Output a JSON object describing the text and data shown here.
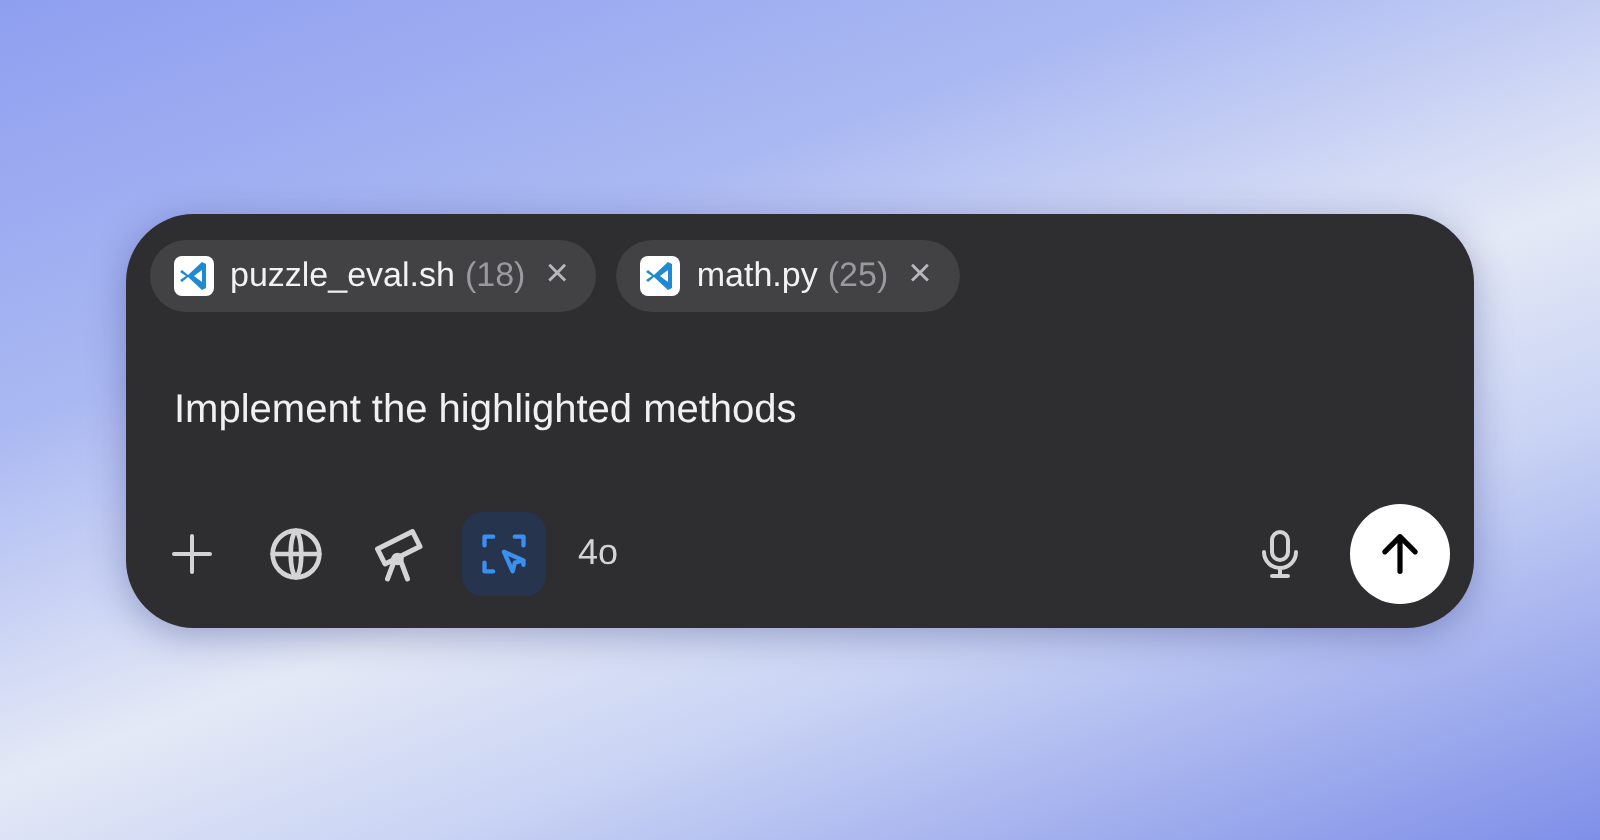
{
  "attachments": [
    {
      "name": "puzzle_eval.sh",
      "count": "(18)",
      "close": "×"
    },
    {
      "name": "math.py",
      "count": "(25)",
      "close": "×"
    }
  ],
  "prompt": "Implement the highlighted methods",
  "tools": [
    {
      "kind": "plus",
      "selected": false
    },
    {
      "kind": "globe",
      "selected": false
    },
    {
      "kind": "telescope",
      "selected": false
    },
    {
      "kind": "screen-select",
      "selected": true
    }
  ],
  "model": "4o",
  "send_button": {
    "enabled": true
  }
}
